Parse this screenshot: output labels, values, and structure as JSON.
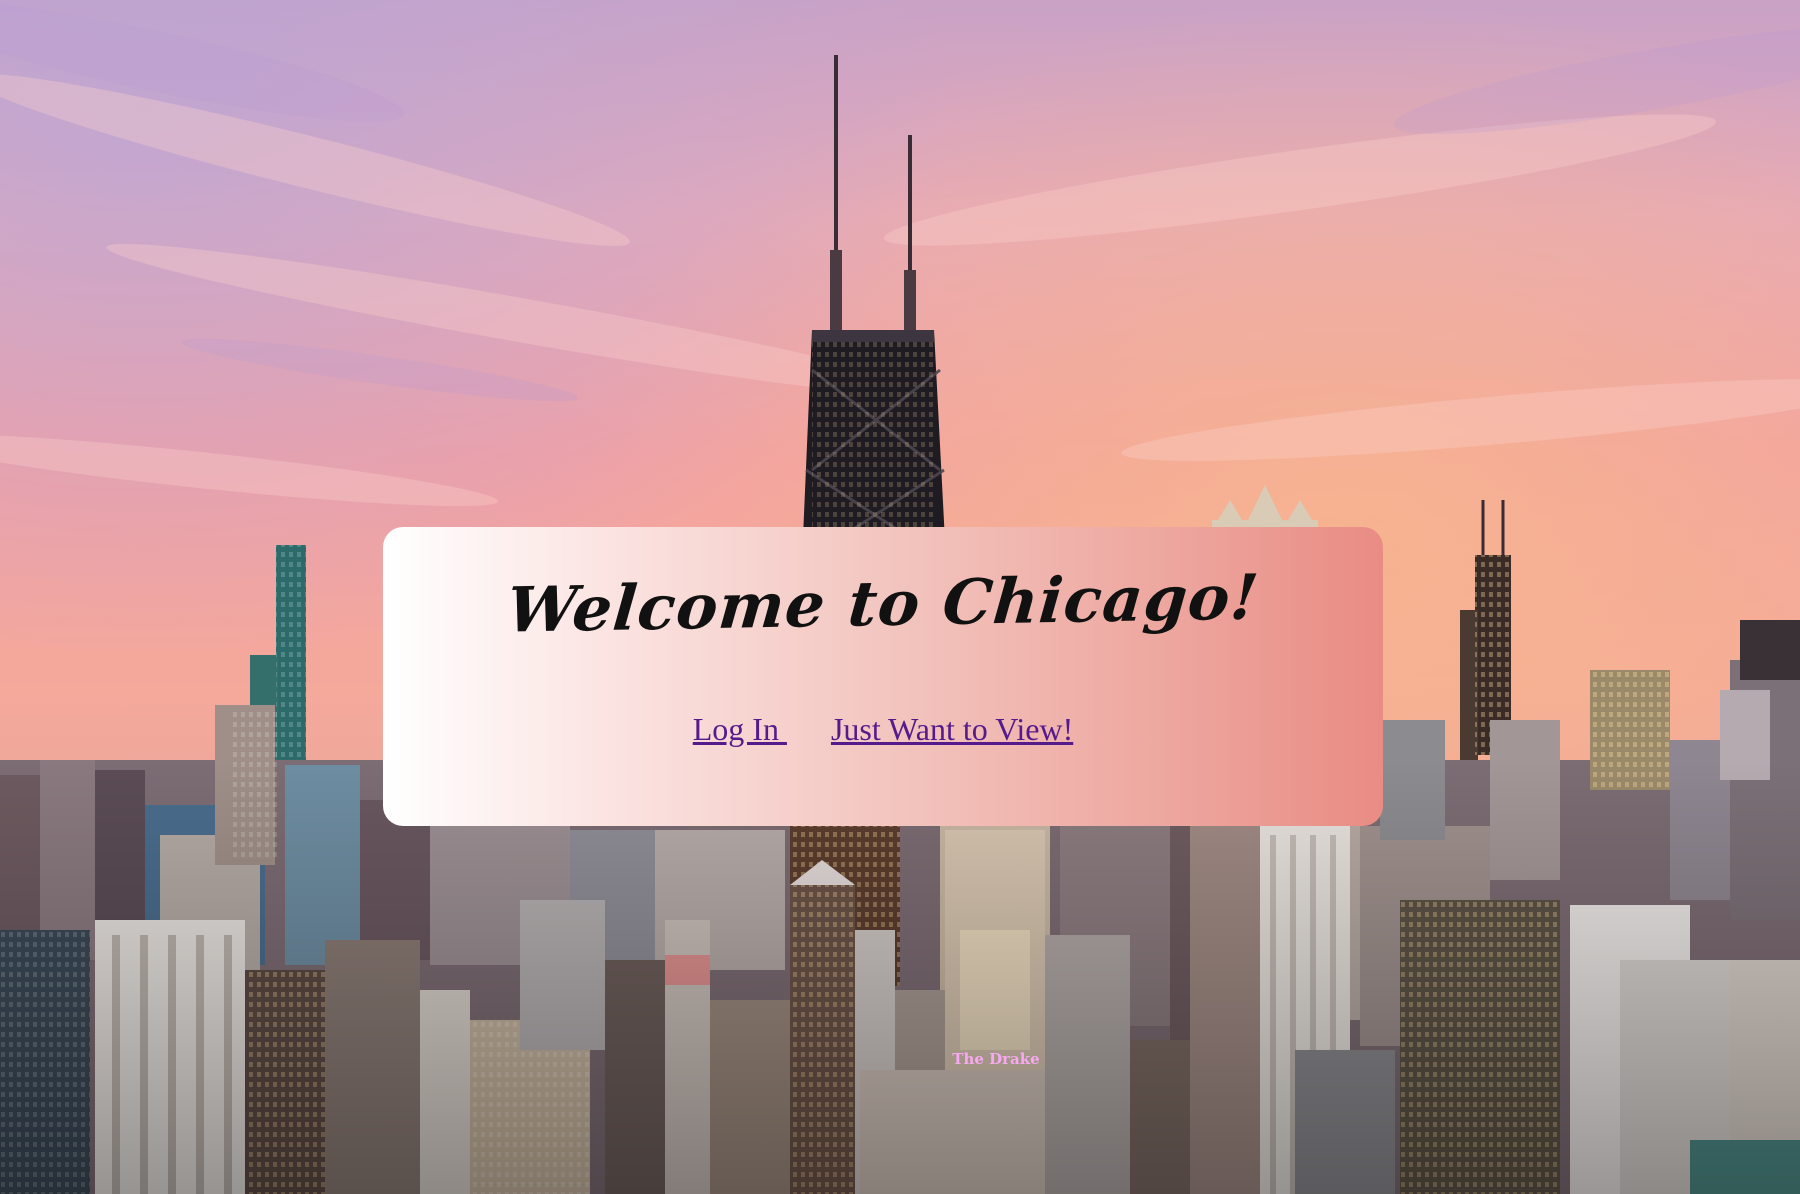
{
  "page": {
    "background": "chicago-skyline-sunset-photo",
    "colors": {
      "sky_top": "#c9a6c8",
      "sky_pink": "#f2a3a6",
      "sky_orange": "#f6b48e",
      "card_left": "#ffffff",
      "card_right": "#e98c84",
      "link": "#551a8b"
    }
  },
  "card": {
    "title": "Welcome to Chicago!",
    "links": {
      "login_label": "Log In ",
      "view_label": "Just Want to View!"
    }
  },
  "scenery": {
    "sign_text": "The Drake"
  }
}
